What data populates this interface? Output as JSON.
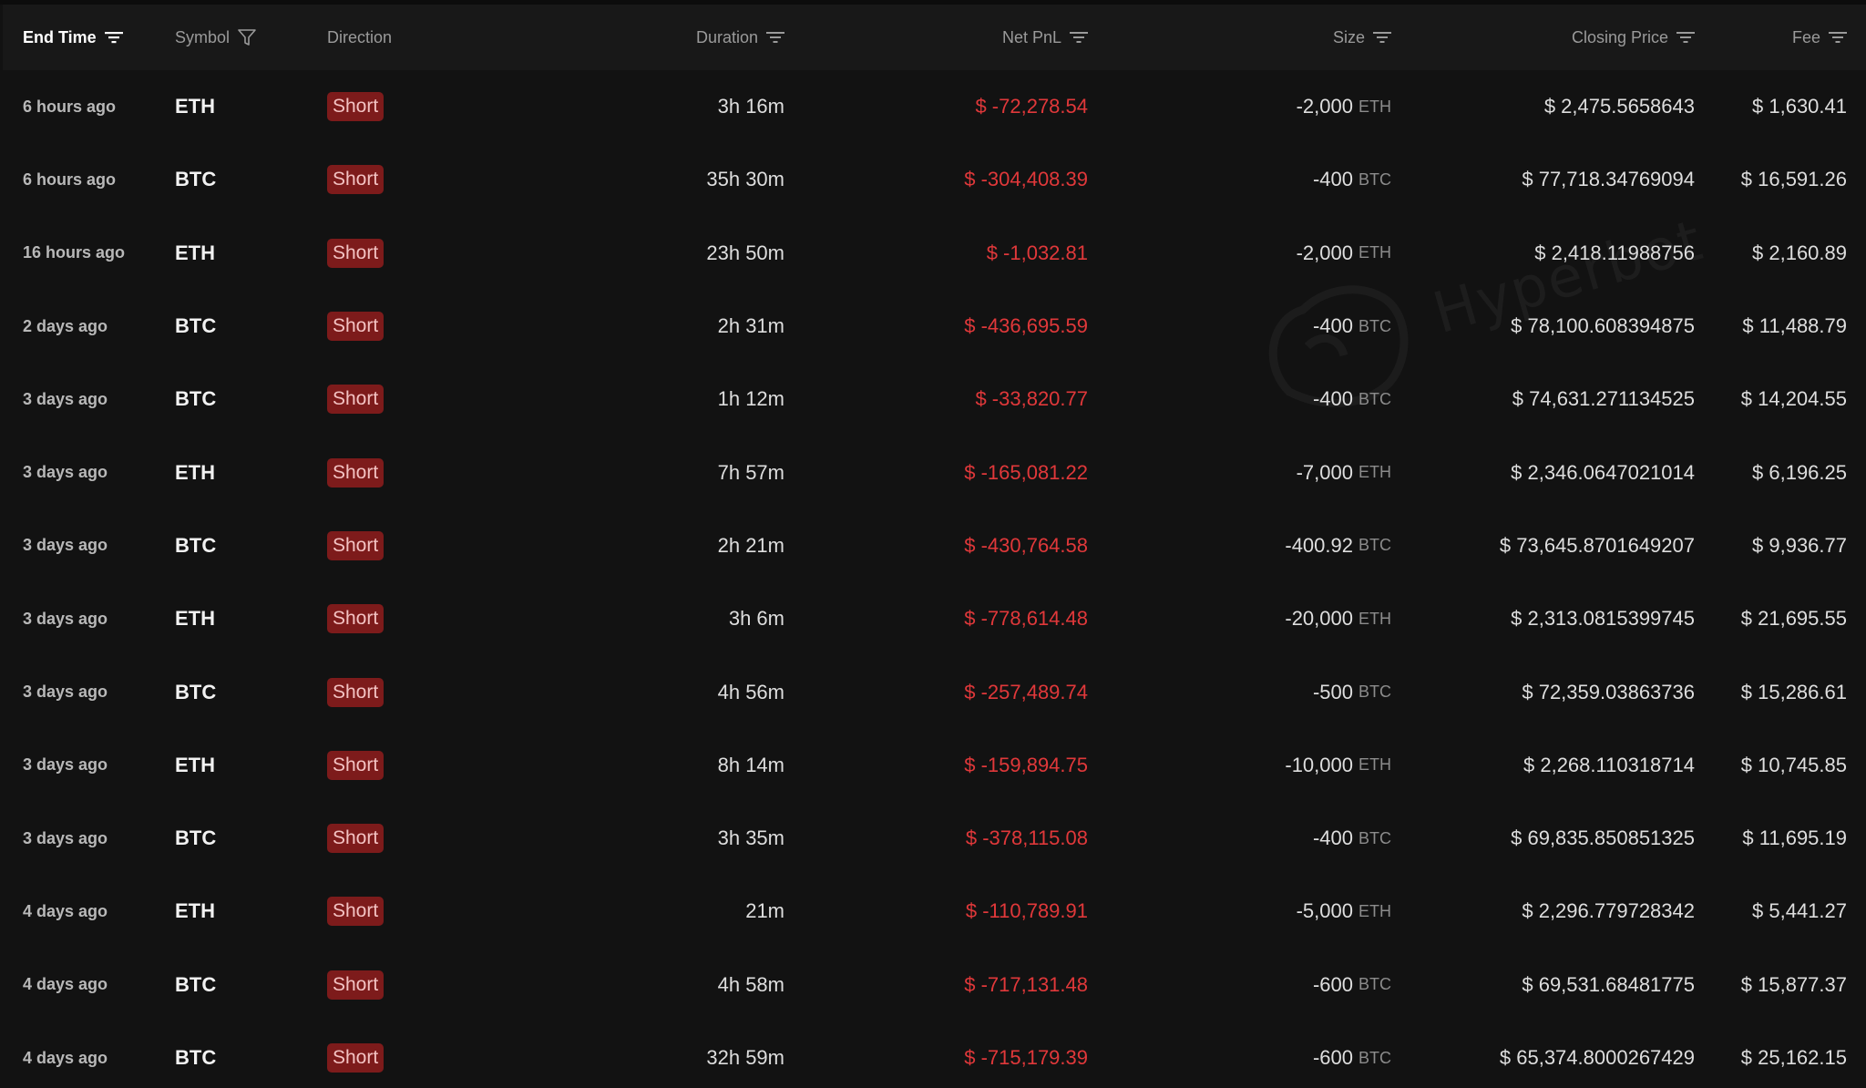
{
  "header": {
    "end_time": "End Time",
    "symbol": "Symbol",
    "direction": "Direction",
    "duration": "Duration",
    "net_pnl": "Net PnL",
    "size": "Size",
    "closing_price": "Closing Price",
    "fee": "Fee"
  },
  "watermark": "Hyperbot",
  "colors": {
    "background": "#121212",
    "header_background": "#181818",
    "short_badge": "#7d1b1b",
    "loss": "#e0383a"
  },
  "rows": [
    {
      "end_time": "6 hours ago",
      "symbol": "ETH",
      "direction": "Short",
      "duration": "3h 16m",
      "net_pnl": "$ -72,278.54",
      "size": "-2,000",
      "size_unit": "ETH",
      "closing_price": "$ 2,475.5658643",
      "fee": "$ 1,630.41"
    },
    {
      "end_time": "6 hours ago",
      "symbol": "BTC",
      "direction": "Short",
      "duration": "35h 30m",
      "net_pnl": "$ -304,408.39",
      "size": "-400",
      "size_unit": "BTC",
      "closing_price": "$ 77,718.34769094",
      "fee": "$ 16,591.26"
    },
    {
      "end_time": "16 hours ago",
      "symbol": "ETH",
      "direction": "Short",
      "duration": "23h 50m",
      "net_pnl": "$ -1,032.81",
      "size": "-2,000",
      "size_unit": "ETH",
      "closing_price": "$ 2,418.11988756",
      "fee": "$ 2,160.89"
    },
    {
      "end_time": "2 days ago",
      "symbol": "BTC",
      "direction": "Short",
      "duration": "2h 31m",
      "net_pnl": "$ -436,695.59",
      "size": "-400",
      "size_unit": "BTC",
      "closing_price": "$ 78,100.608394875",
      "fee": "$ 11,488.79"
    },
    {
      "end_time": "3 days ago",
      "symbol": "BTC",
      "direction": "Short",
      "duration": "1h 12m",
      "net_pnl": "$ -33,820.77",
      "size": "-400",
      "size_unit": "BTC",
      "closing_price": "$ 74,631.271134525",
      "fee": "$ 14,204.55"
    },
    {
      "end_time": "3 days ago",
      "symbol": "ETH",
      "direction": "Short",
      "duration": "7h 57m",
      "net_pnl": "$ -165,081.22",
      "size": "-7,000",
      "size_unit": "ETH",
      "closing_price": "$ 2,346.0647021014",
      "fee": "$ 6,196.25"
    },
    {
      "end_time": "3 days ago",
      "symbol": "BTC",
      "direction": "Short",
      "duration": "2h 21m",
      "net_pnl": "$ -430,764.58",
      "size": "-400.92",
      "size_unit": "BTC",
      "closing_price": "$ 73,645.8701649207",
      "fee": "$ 9,936.77"
    },
    {
      "end_time": "3 days ago",
      "symbol": "ETH",
      "direction": "Short",
      "duration": "3h 6m",
      "net_pnl": "$ -778,614.48",
      "size": "-20,000",
      "size_unit": "ETH",
      "closing_price": "$ 2,313.0815399745",
      "fee": "$ 21,695.55"
    },
    {
      "end_time": "3 days ago",
      "symbol": "BTC",
      "direction": "Short",
      "duration": "4h 56m",
      "net_pnl": "$ -257,489.74",
      "size": "-500",
      "size_unit": "BTC",
      "closing_price": "$ 72,359.03863736",
      "fee": "$ 15,286.61"
    },
    {
      "end_time": "3 days ago",
      "symbol": "ETH",
      "direction": "Short",
      "duration": "8h 14m",
      "net_pnl": "$ -159,894.75",
      "size": "-10,000",
      "size_unit": "ETH",
      "closing_price": "$ 2,268.110318714",
      "fee": "$ 10,745.85"
    },
    {
      "end_time": "3 days ago",
      "symbol": "BTC",
      "direction": "Short",
      "duration": "3h 35m",
      "net_pnl": "$ -378,115.08",
      "size": "-400",
      "size_unit": "BTC",
      "closing_price": "$ 69,835.850851325",
      "fee": "$ 11,695.19"
    },
    {
      "end_time": "4 days ago",
      "symbol": "ETH",
      "direction": "Short",
      "duration": "21m",
      "net_pnl": "$ -110,789.91",
      "size": "-5,000",
      "size_unit": "ETH",
      "closing_price": "$ 2,296.779728342",
      "fee": "$ 5,441.27"
    },
    {
      "end_time": "4 days ago",
      "symbol": "BTC",
      "direction": "Short",
      "duration": "4h 58m",
      "net_pnl": "$ -717,131.48",
      "size": "-600",
      "size_unit": "BTC",
      "closing_price": "$ 69,531.68481775",
      "fee": "$ 15,877.37"
    },
    {
      "end_time": "4 days ago",
      "symbol": "BTC",
      "direction": "Short",
      "duration": "32h 59m",
      "net_pnl": "$ -715,179.39",
      "size": "-600",
      "size_unit": "BTC",
      "closing_price": "$ 65,374.8000267429",
      "fee": "$ 25,162.15"
    }
  ]
}
